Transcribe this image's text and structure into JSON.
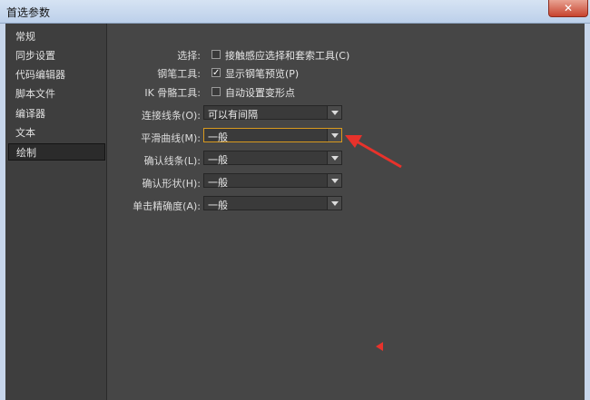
{
  "window": {
    "title": "首选参数",
    "close_glyph": "✕"
  },
  "sidebar": {
    "items": [
      {
        "label": "常规"
      },
      {
        "label": "同步设置"
      },
      {
        "label": "代码编辑器"
      },
      {
        "label": "脚本文件"
      },
      {
        "label": "编译器"
      },
      {
        "label": "文本"
      },
      {
        "label": "绘制"
      }
    ],
    "selected": "绘制"
  },
  "drawing": {
    "select_label": "选择:",
    "select_option": "接触感应选择和套索工具(C)",
    "select_checked": false,
    "pen_label": "钢笔工具:",
    "pen_option": "显示钢笔预览(P)",
    "pen_checked": true,
    "ik_label": "IK 骨骼工具:",
    "ik_option": "自动设置变形点",
    "ik_checked": false,
    "connect_label": "连接线条(O):",
    "connect_value": "可以有间隔",
    "smooth_label": "平滑曲线(M):",
    "smooth_value": "一般",
    "recognize_lines_label": "确认线条(L):",
    "recognize_lines_value": "一般",
    "recognize_shapes_label": "确认形状(H):",
    "recognize_shapes_value": "一般",
    "click_accuracy_label": "单击精确度(A):",
    "click_accuracy_value": "一般"
  },
  "colors": {
    "annotation_red": "#e8322b",
    "focus_orange": "#d99a1e"
  }
}
